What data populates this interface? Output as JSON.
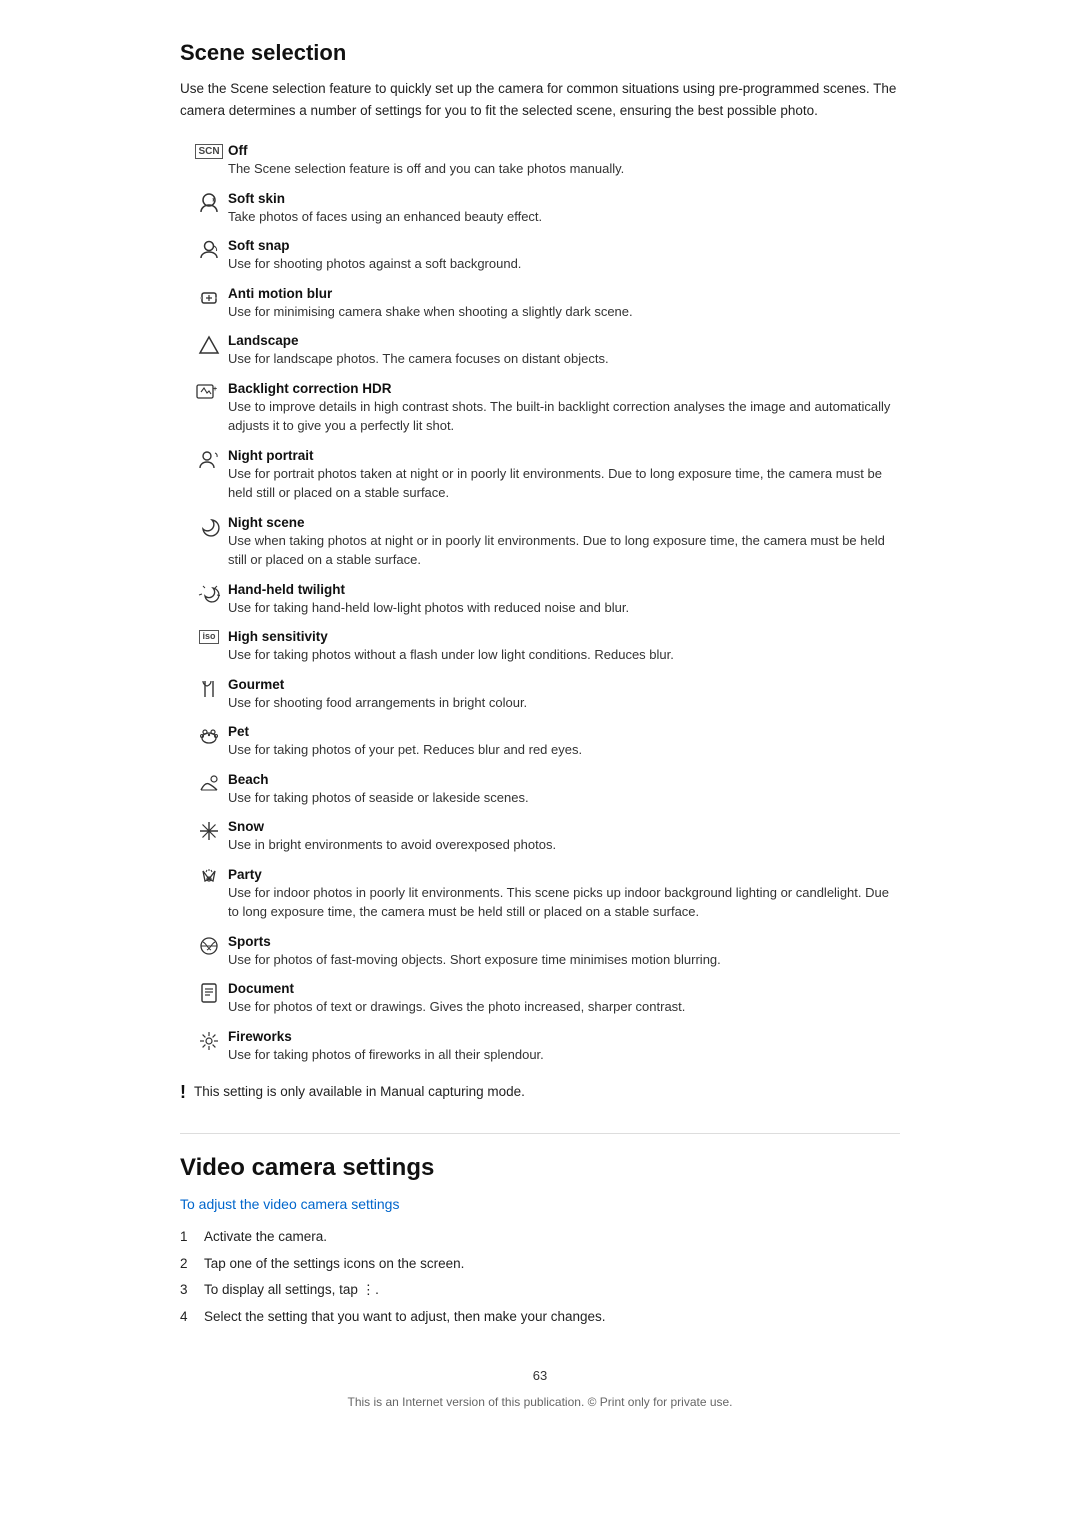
{
  "page": {
    "section1": {
      "title": "Scene selection",
      "intro": "Use the Scene selection feature to quickly set up the camera for common situations using pre-programmed scenes. The camera determines a number of settings for you to fit the selected scene, ensuring the best possible photo."
    },
    "scenes": [
      {
        "icon": "SCN",
        "icon_type": "text",
        "name": "Off",
        "desc": "The Scene selection feature is off and you can take photos manually."
      },
      {
        "icon": "🌸",
        "icon_type": "emoji",
        "name": "Soft skin",
        "desc": "Take photos of faces using an enhanced beauty effect."
      },
      {
        "icon": "👤",
        "icon_type": "emoji",
        "name": "Soft snap",
        "desc": "Use for shooting photos against a soft background."
      },
      {
        "icon": "🤸",
        "icon_type": "emoji",
        "name": "Anti motion blur",
        "desc": "Use for minimising camera shake when shooting a slightly dark scene."
      },
      {
        "icon": "▲",
        "icon_type": "emoji",
        "name": "Landscape",
        "desc": "Use for landscape photos. The camera focuses on distant objects."
      },
      {
        "icon": "📷+",
        "icon_type": "emoji",
        "name": "Backlight correction HDR",
        "desc": "Use to improve details in high contrast shots. The built-in backlight correction analyses the image and automatically adjusts it to give you a perfectly lit shot."
      },
      {
        "icon": "👤✨",
        "icon_type": "emoji",
        "name": "Night portrait",
        "desc": "Use for portrait photos taken at night or in poorly lit environments. Due to long exposure time, the camera must be held still or placed on a stable surface."
      },
      {
        "icon": "☽",
        "icon_type": "emoji",
        "name": "Night scene",
        "desc": "Use when taking photos at night or in poorly lit environments. Due to long exposure time, the camera must be held still or placed on a stable surface."
      },
      {
        "icon": "✨🌙",
        "icon_type": "emoji",
        "name": "Hand-held twilight",
        "desc": "Use for taking hand-held low-light photos with reduced noise and blur."
      },
      {
        "icon": "ISO",
        "icon_type": "text",
        "name": "High sensitivity",
        "desc": "Use for taking photos without a flash under low light conditions. Reduces blur."
      },
      {
        "icon": "🍴",
        "icon_type": "emoji",
        "name": "Gourmet",
        "desc": "Use for shooting food arrangements in bright colour."
      },
      {
        "icon": "🐾",
        "icon_type": "emoji",
        "name": "Pet",
        "desc": "Use for taking photos of your pet. Reduces blur and red eyes."
      },
      {
        "icon": "🏖",
        "icon_type": "emoji",
        "name": "Beach",
        "desc": "Use for taking photos of seaside or lakeside scenes."
      },
      {
        "icon": "❄",
        "icon_type": "emoji",
        "name": "Snow",
        "desc": "Use in bright environments to avoid overexposed photos."
      },
      {
        "icon": "✨🎉",
        "icon_type": "emoji",
        "name": "Party",
        "desc": "Use for indoor photos in poorly lit environments. This scene picks up indoor background lighting or candlelight. Due to long exposure time, the camera must be held still or placed on a stable surface."
      },
      {
        "icon": "🏃",
        "icon_type": "emoji",
        "name": "Sports",
        "desc": "Use for photos of fast-moving objects. Short exposure time minimises motion blurring."
      },
      {
        "icon": "📄",
        "icon_type": "emoji",
        "name": "Document",
        "desc": "Use for photos of text or drawings. Gives the photo increased, sharper contrast."
      },
      {
        "icon": "🎆",
        "icon_type": "emoji",
        "name": "Fireworks",
        "desc": "Use for taking photos of fireworks in all their splendour."
      }
    ],
    "note": "This setting is only available in Manual capturing mode.",
    "section2": {
      "title": "Video camera settings",
      "link": "To adjust the video camera settings",
      "steps": [
        "Activate the camera.",
        "Tap one of the settings icons on the screen.",
        "To display all settings, tap ⋮.",
        "Select the setting that you want to adjust, then make your changes."
      ]
    },
    "footer": {
      "page_number": "63",
      "note": "This is an Internet version of this publication. © Print only for private use."
    }
  }
}
